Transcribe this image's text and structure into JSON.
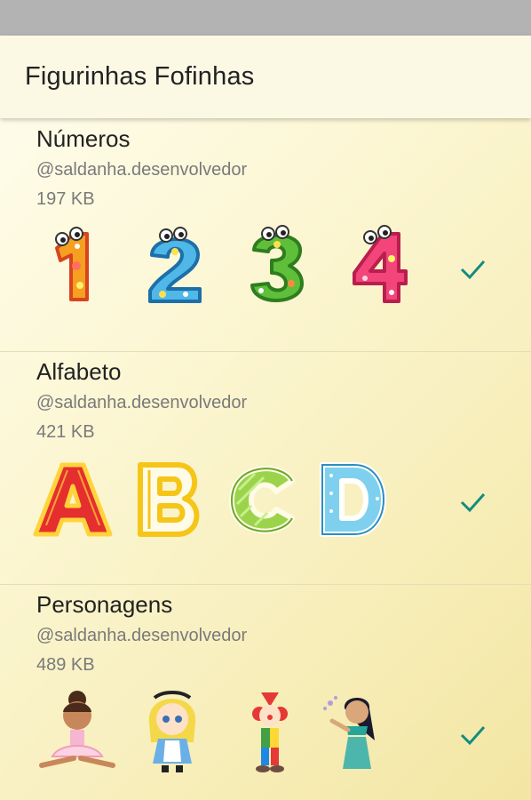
{
  "app": {
    "title": "Figurinhas Fofinhas"
  },
  "colors": {
    "accent": "#128c7e",
    "background": "#fbf5cf",
    "secondary_text": "#7a7a7a"
  },
  "packs": [
    {
      "name": "Números",
      "author": "@saldanha.desenvolvedor",
      "size": "197 KB",
      "stickers": [
        "number-1-sticker",
        "number-2-sticker",
        "number-3-sticker",
        "number-4-sticker"
      ],
      "added": true,
      "status_icon": "checkmark-icon"
    },
    {
      "name": "Alfabeto",
      "author": "@saldanha.desenvolvedor",
      "size": "421 KB",
      "stickers": [
        "letter-a-sticker",
        "letter-b-sticker",
        "letter-c-sticker",
        "letter-d-sticker"
      ],
      "added": true,
      "status_icon": "checkmark-icon"
    },
    {
      "name": "Personagens",
      "author": "@saldanha.desenvolvedor",
      "size": "489 KB",
      "stickers": [
        "ballerina-sticker",
        "alice-sticker",
        "clown-sticker",
        "jasmine-sticker"
      ],
      "added": true,
      "status_icon": "checkmark-icon"
    }
  ]
}
